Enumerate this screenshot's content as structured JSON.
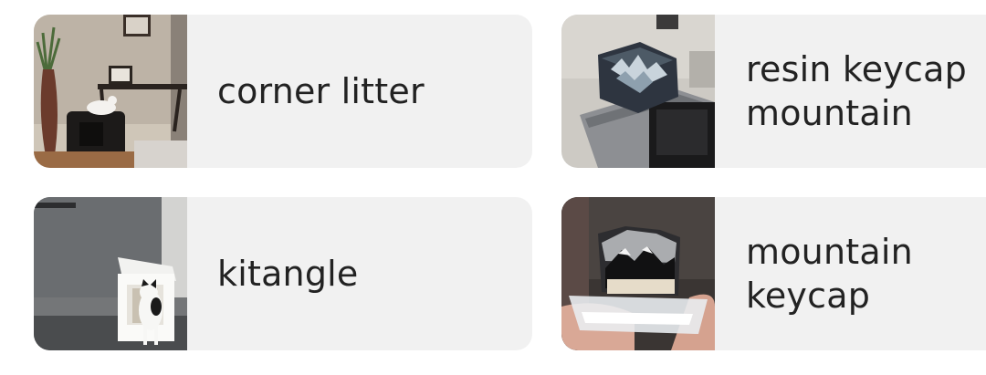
{
  "suggestions": [
    {
      "label": "corner litter",
      "image": "corner-litter-box-photo"
    },
    {
      "label": "resin keycap\nmountain",
      "image": "resin-keycap-photo"
    },
    {
      "label": "kitangle",
      "image": "cat-box-photo"
    },
    {
      "label": "mountain\nkeycap",
      "image": "mountain-keycap-photo"
    }
  ]
}
